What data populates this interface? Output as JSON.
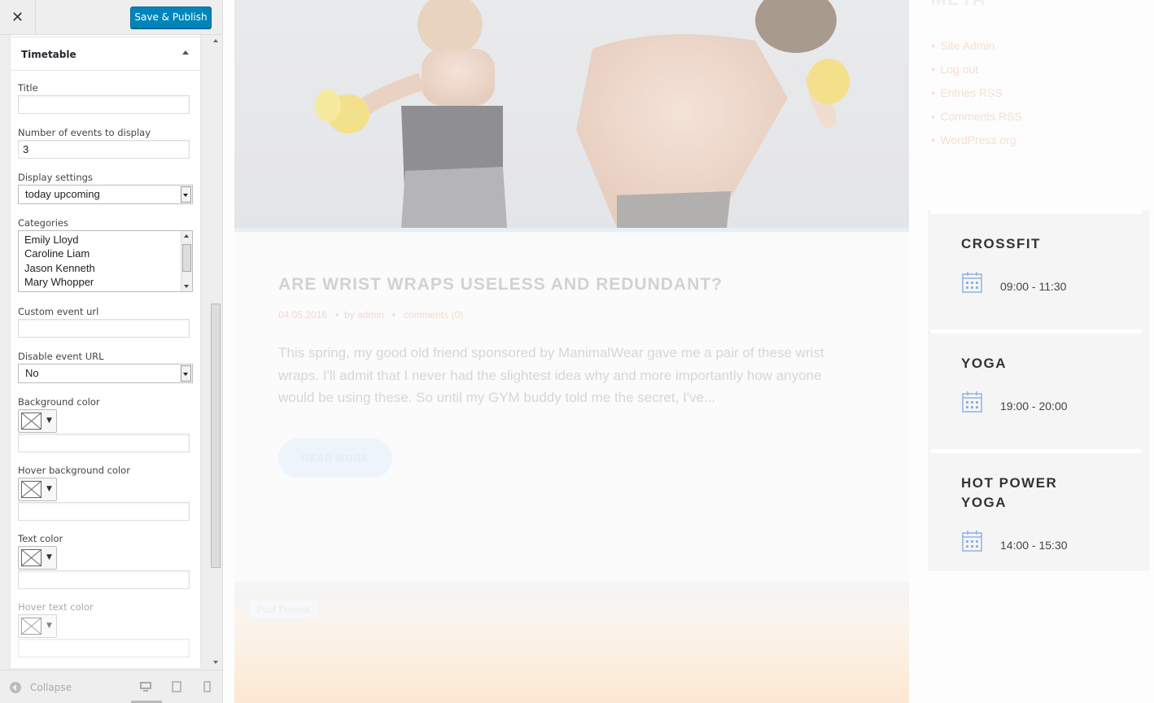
{
  "toolbar": {
    "close": "✕",
    "publish": "Save & Publish"
  },
  "widget": {
    "title": "Timetable",
    "fields": {
      "title_label": "Title",
      "title_value": "",
      "events_label": "Number of events to display",
      "events_value": "3",
      "display_label": "Display settings",
      "display_value": "today upcoming",
      "categories_label": "Categories",
      "categories": [
        "Emily Lloyd",
        "Caroline Liam",
        "Jason Kenneth",
        "Mary Whopper"
      ],
      "custom_url_label": "Custom event url",
      "custom_url_value": "",
      "disable_url_label": "Disable event URL",
      "disable_url_value": "No",
      "bg_color_label": "Background color",
      "hover_bg_label": "Hover background color",
      "text_color_label": "Text color",
      "hover_text_label": "Hover text color"
    }
  },
  "footer": {
    "collapse": "Collapse"
  },
  "preview": {
    "post": {
      "title": "ARE WRIST WRAPS USELESS AND REDUNDANT?",
      "date": "04.05.2016",
      "by": "by",
      "author": "admin",
      "comments": "comments (0)",
      "excerpt": "This spring, my good old friend sponsored by ManimalWear gave me a pair of these wrist wraps. I'll admit that I never had the slightest idea why and more importantly how anyone would be using these. So until my GYM buddy told me the secret, I've...",
      "read_more": "READ MORE",
      "post_format": "Post Format"
    },
    "meta": {
      "title": "META",
      "links": [
        "Site Admin",
        "Log out",
        "Entries RSS",
        "Comments RSS",
        "WordPress.org"
      ]
    },
    "timetable": [
      {
        "name": "CROSSFIT",
        "time": "09:00 - 11:30"
      },
      {
        "name": "YOGA",
        "time": "19:00 - 20:00"
      },
      {
        "name": "HOT POWER YOGA",
        "time": "14:00 - 15:30"
      }
    ]
  },
  "colors": {
    "accent": "#0085ba",
    "calendar_icon": "#8fb3e0",
    "meta_link": "#f6ddd4"
  },
  "icons": {
    "close": "close-icon",
    "collapse": "collapse-icon",
    "calendar": "calendar-icon",
    "desktop": "desktop-icon",
    "tablet": "tablet-icon",
    "mobile": "mobile-icon"
  }
}
